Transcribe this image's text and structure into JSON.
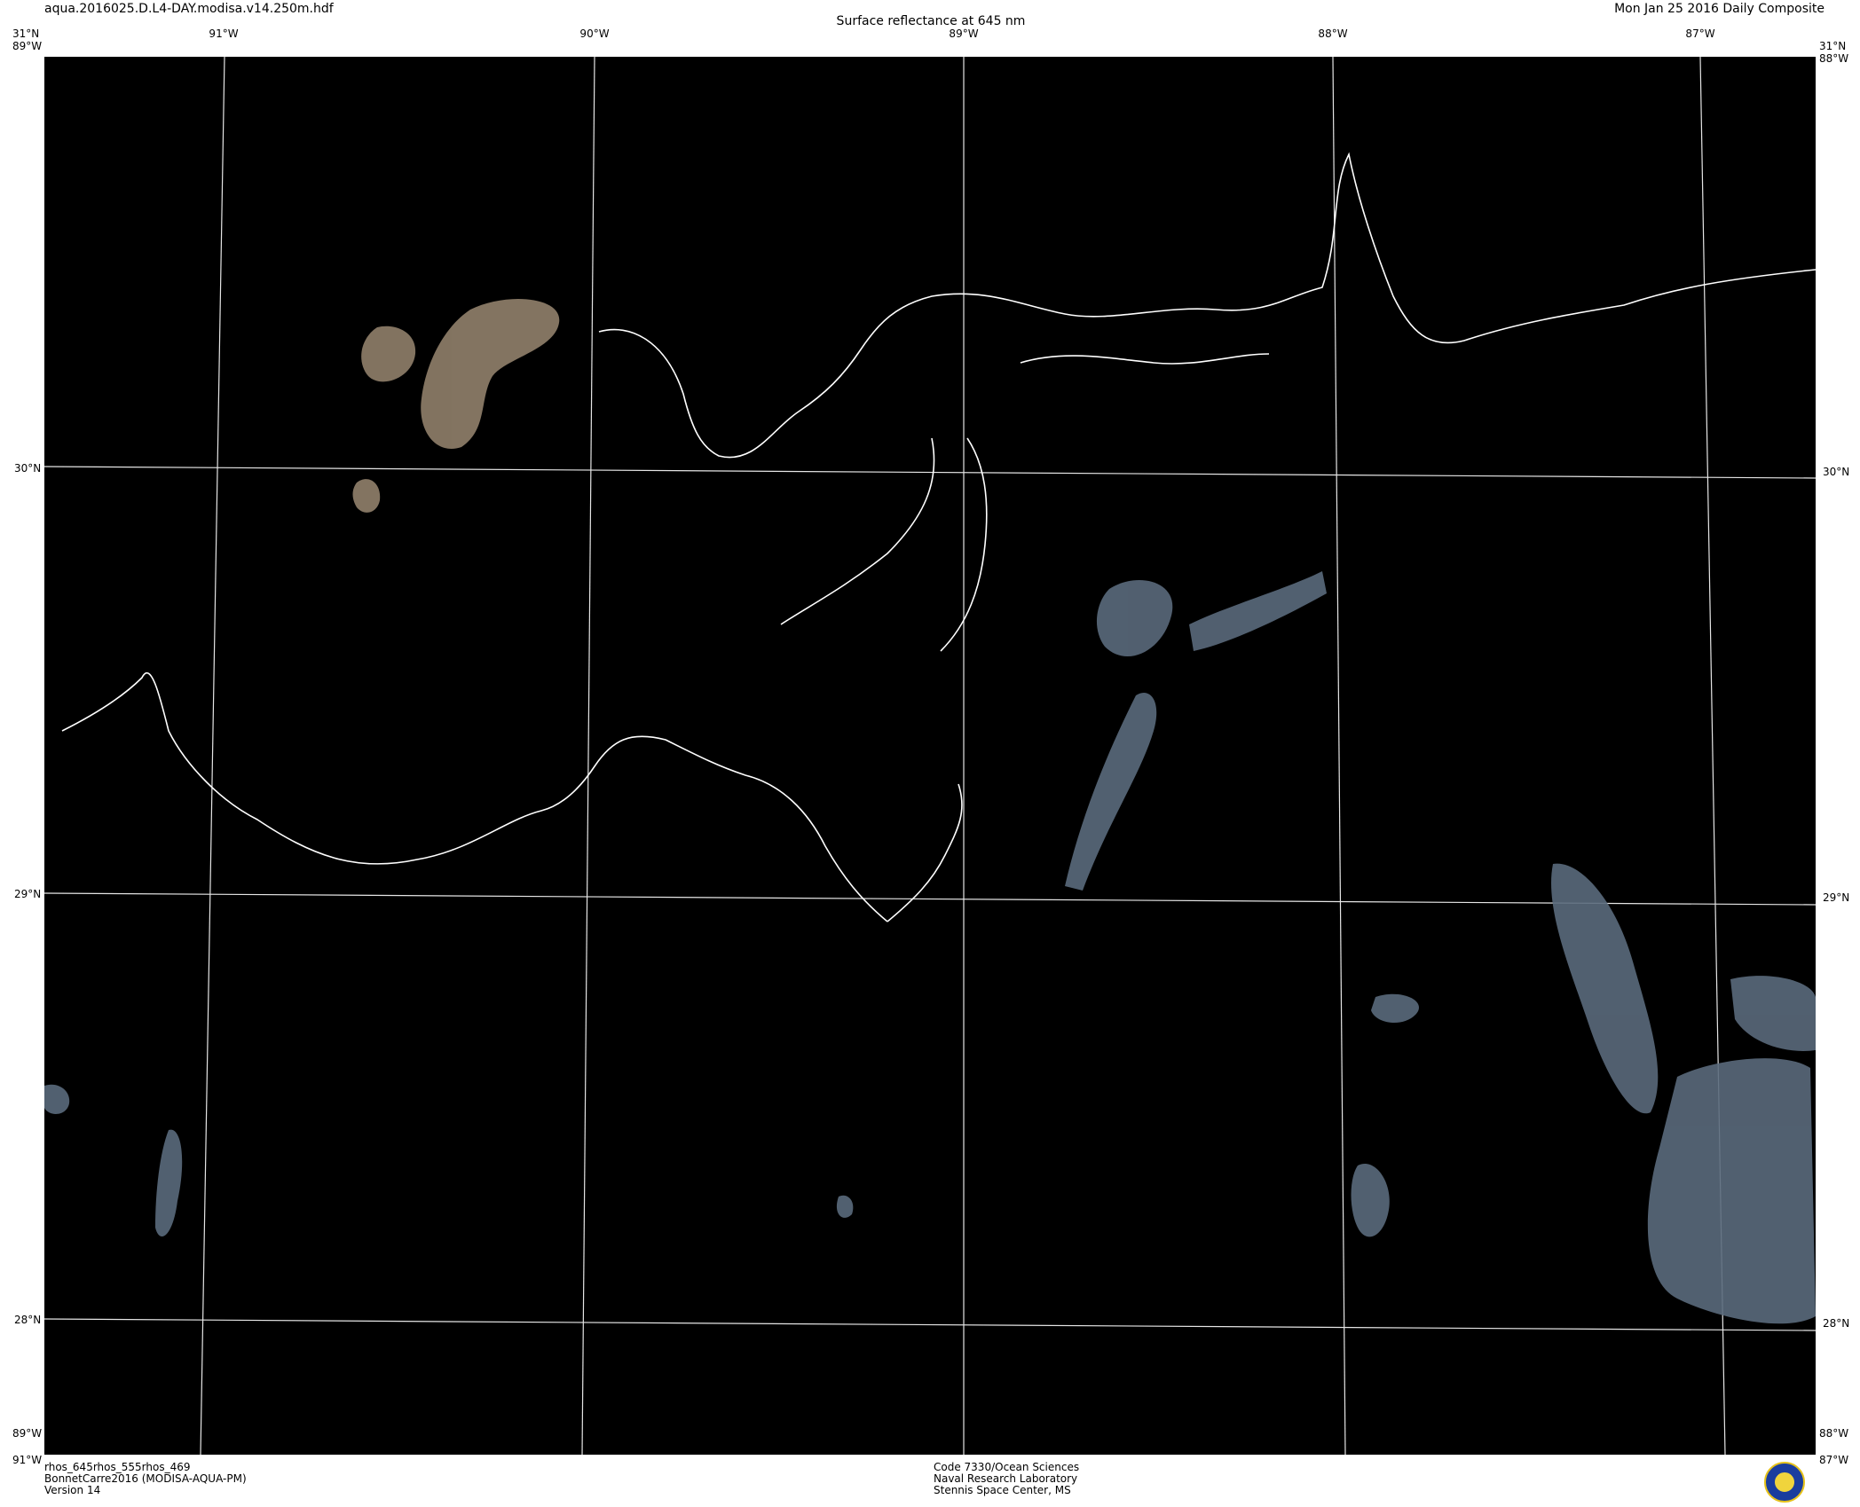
{
  "header": {
    "filename": "aqua.2016025.D.L4-DAY.modisa.v14.250m.hdf",
    "title": "Surface reflectance at 645 nm",
    "date": "Mon Jan 25 2016 Daily Composite"
  },
  "grid": {
    "top_lon_labels": [
      "91°W",
      "90°W",
      "89°W",
      "88°W",
      "87°W"
    ],
    "left_lat_labels": [
      "30°N",
      "29°N",
      "28°N"
    ],
    "right_lat_labels": [
      "30°N",
      "29°N",
      "28°N"
    ],
    "corner_top_left": "31°N",
    "corner_top_right": "31°N",
    "corner_bottom_left": "91°W",
    "corner_bottom_right": "87°W",
    "edge_left_top": "89°W",
    "edge_right_top": "88°W",
    "edge_left_bottom": "89°W",
    "edge_right_bottom": "88°W"
  },
  "footer": {
    "left_lines": [
      "rhos_645rhos_555rhos_469",
      "BonnetCarre2016 (MODISA-AQUA-PM)",
      "Version 14"
    ],
    "center_lines": [
      "Code 7330/Ocean Sciences",
      "Naval Research Laboratory",
      "Stennis Space Center, MS"
    ]
  },
  "colors": {
    "background": "#000000",
    "grid_lines": "#ffffff",
    "coastline": "#ffffff",
    "lake_sediment": "#8a7a66",
    "cloud_patches": "#5a6a7c"
  },
  "icons": {
    "logo": "nrl-seal-icon"
  }
}
